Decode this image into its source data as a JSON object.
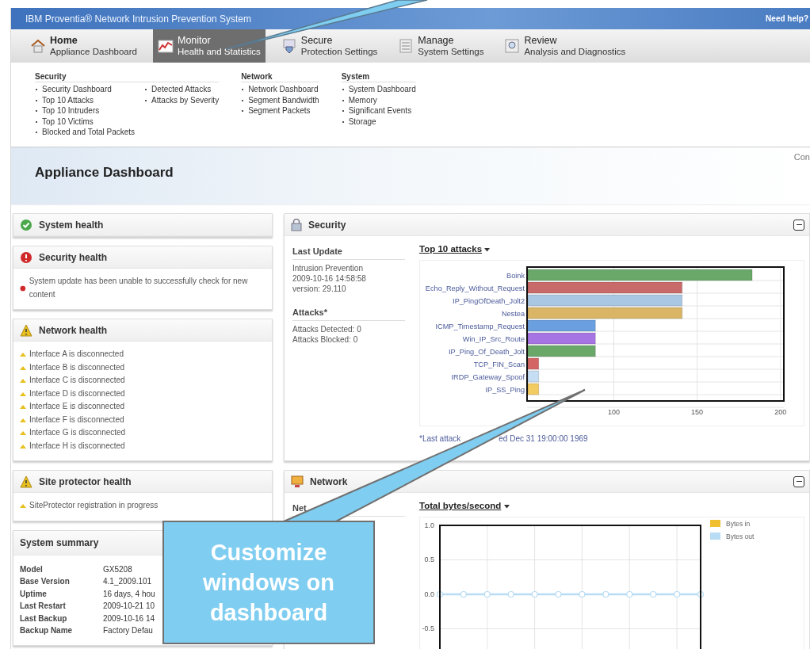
{
  "header": {
    "title": "IBM Proventia® Network Intrusion Prevention System",
    "help": "Need help?"
  },
  "nav_tabs": [
    {
      "title": "Home",
      "subtitle": "Appliance Dashboard",
      "selected": false
    },
    {
      "title": "Monitor",
      "subtitle": "Health and Statistics",
      "selected": true
    },
    {
      "title": "Secure",
      "subtitle": "Protection Settings",
      "selected": false
    },
    {
      "title": "Manage",
      "subtitle": "System Settings",
      "selected": false
    },
    {
      "title": "Review",
      "subtitle": "Analysis and Diagnostics",
      "selected": false
    }
  ],
  "submenu": [
    {
      "heading": "Security",
      "columns": [
        [
          "Security Dashboard",
          "Top 10 Attacks",
          "Top 10 Intruders",
          "Top 10 Victims",
          "Blocked and Total Packets"
        ],
        [
          "Detected Attacks",
          "Attacks by Severity"
        ]
      ]
    },
    {
      "heading": "Network",
      "columns": [
        [
          "Network Dashboard",
          "Segment Bandwidth",
          "Segment Packets"
        ]
      ]
    },
    {
      "heading": "System",
      "columns": [
        [
          "System Dashboard",
          "Memory",
          "Significant Events",
          "Storage"
        ]
      ]
    }
  ],
  "page": {
    "title": "Appliance Dashboard",
    "edge_text": "Con"
  },
  "health_panels": [
    {
      "title": "System health",
      "kind": "ok"
    },
    {
      "title": "Security health",
      "kind": "error",
      "items": [
        "System update has been unable to successfully check for new content"
      ]
    },
    {
      "title": "Network health",
      "kind": "warning",
      "items": [
        "Interface A is disconnected",
        "Interface B is disconnected",
        "Interface C is disconnected",
        "Interface D is disconnected",
        "Interface E is disconnected",
        "Interface F is disconnected",
        "Interface G is disconnected",
        "Interface H is disconnected"
      ]
    },
    {
      "title": "Site protector health",
      "kind": "warning",
      "items": [
        "SiteProtector registration in progress"
      ]
    }
  ],
  "system_summary": {
    "title": "System summary",
    "rows": [
      {
        "label": "Model",
        "value": "GX5208"
      },
      {
        "label": "Base Version",
        "value": "4.1_2009.101"
      },
      {
        "label": "Uptime",
        "value": "16 days, 4 hou"
      },
      {
        "label": "Last Restart",
        "value": "2009-10-21 10"
      },
      {
        "label": "Last Backup",
        "value": "2009-10-16 14"
      },
      {
        "label": "Backup Name",
        "value": "Factory Defau"
      }
    ]
  },
  "security_panel": {
    "title": "Security",
    "sections": [
      {
        "heading": "Last Update",
        "lines": [
          "Intrusion Prevention",
          "2009-10-16 14:58:58",
          "version: 29.110"
        ]
      },
      {
        "heading": "Attacks*",
        "lines": [
          "Attacks Detected: 0",
          "Attacks Blocked: 0"
        ]
      }
    ],
    "chart_title": "Top 10 attacks",
    "chart_data": {
      "type": "bar",
      "orientation": "horizontal",
      "categories": [
        "Boink",
        "Echo_Reply_Without_Request",
        "IP_PingOfDeath_Jolt2",
        "Nestea",
        "ICMP_Timestamp_Request",
        "Win_IP_Src_Route",
        "IP_Ping_Of_Death_Jolt",
        "TCP_FIN_Scan",
        "IRDP_Gateway_Spoof",
        "IP_SS_Ping"
      ],
      "values": [
        183,
        141,
        141,
        141,
        89,
        89,
        89,
        55,
        55,
        55
      ],
      "xlim": [
        48,
        202
      ],
      "xticks": [
        100,
        150,
        200
      ],
      "grid": true
    },
    "footnote_parts": [
      "*Last attack",
      "ed Dec 31 19:00:00 1969"
    ]
  },
  "network_panel": {
    "title": "Network",
    "side_label": "Net",
    "chart_title": "Total bytes/second",
    "chart_data": {
      "type": "line",
      "grid": true,
      "legend": true,
      "ylim": [
        -0.8,
        1.0
      ],
      "yticks": [
        {
          "value": 1.0,
          "label": "1.0"
        },
        {
          "value": 0.5,
          "label": "0.5"
        },
        {
          "value": 0,
          "label": "0.0"
        },
        {
          "value": -0.5,
          "label": "-0.5"
        }
      ],
      "series": [
        {
          "name": "Bytes in",
          "color": "#f0c030",
          "marker": "circle",
          "values": [
            null,
            null,
            null,
            null,
            null,
            null,
            null,
            null,
            null,
            null,
            null,
            null
          ]
        },
        {
          "name": "Bytes out",
          "color": "#b8dcf4",
          "marker": "circle",
          "values": [
            0,
            0,
            0,
            0,
            0,
            0,
            0,
            0,
            0,
            0,
            0,
            0
          ]
        }
      ]
    }
  },
  "callout": {
    "text": "Customize windows on dashboard"
  }
}
